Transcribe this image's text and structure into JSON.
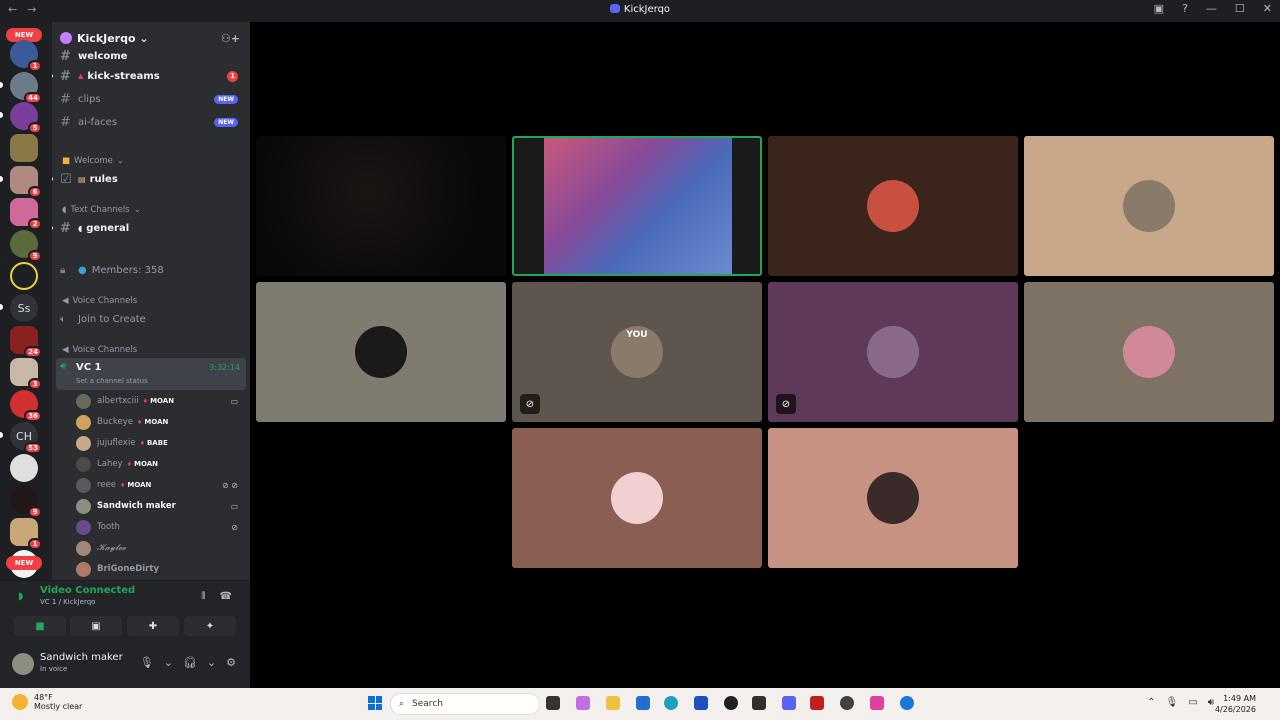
{
  "window": {
    "title": "KickJerqo",
    "nav_back": "←",
    "nav_forward": "→"
  },
  "servers": {
    "new_label": "NEW",
    "text_icons": [
      "Ss",
      "CH"
    ],
    "badges": [
      "1",
      "44",
      "5",
      "6",
      "2",
      "9",
      "24",
      "3",
      "36",
      "53",
      "9",
      "1"
    ]
  },
  "server": {
    "name": "KickJerqo",
    "channels": [
      {
        "label": "welcome"
      },
      {
        "label": "kick-streams",
        "badge": "1"
      },
      {
        "label": "clips",
        "tag": "NEW"
      },
      {
        "label": "ai-faces",
        "tag": "NEW"
      }
    ],
    "cat_welcome": "Welcome",
    "rules": "rules",
    "cat_text": "Text Channels",
    "general": "general",
    "members": "Members: 358",
    "cat_voice1": "Voice Channels",
    "join_create": "Join to Create",
    "cat_voice2": "Voice Channels"
  },
  "vc": {
    "name": "VC 1",
    "timer": "3:32:14",
    "status": "Set a channel status",
    "members": [
      {
        "name": "albertxciii",
        "role": "MOAN",
        "icons": "▭"
      },
      {
        "name": "Buckeye",
        "role": "MOAN",
        "icons": ""
      },
      {
        "name": "jujuflexie",
        "role": "BABE",
        "icons": ""
      },
      {
        "name": "Lahey",
        "role": "MOAN",
        "icons": ""
      },
      {
        "name": "reee",
        "role": "MOAN",
        "icons": "⊘ ⊘"
      },
      {
        "name": "Sandwich maker",
        "role": "",
        "icons": "▭"
      },
      {
        "name": "Tooth",
        "role": "",
        "icons": "⊘"
      },
      {
        "name": "𝓚𝓪𝔂𝓵𝓮𝓮",
        "role": "",
        "icons": ""
      },
      {
        "name": "BriGoneDirty",
        "role": "",
        "icons": ""
      }
    ]
  },
  "voice_panel": {
    "status": "Video Connected",
    "channel": "VC 1 / KickJerqo"
  },
  "user": {
    "name": "Sandwich maker",
    "status": "In voice"
  },
  "stage": {
    "you_label": "YOU"
  },
  "taskbar": {
    "temp": "48°F",
    "weather": "Mostly clear",
    "search": "Search",
    "time": "1:49 AM",
    "date": "4/26/2026"
  },
  "colors": {
    "accent": "#5865f2",
    "online": "#23a55a",
    "danger": "#f23f43"
  }
}
